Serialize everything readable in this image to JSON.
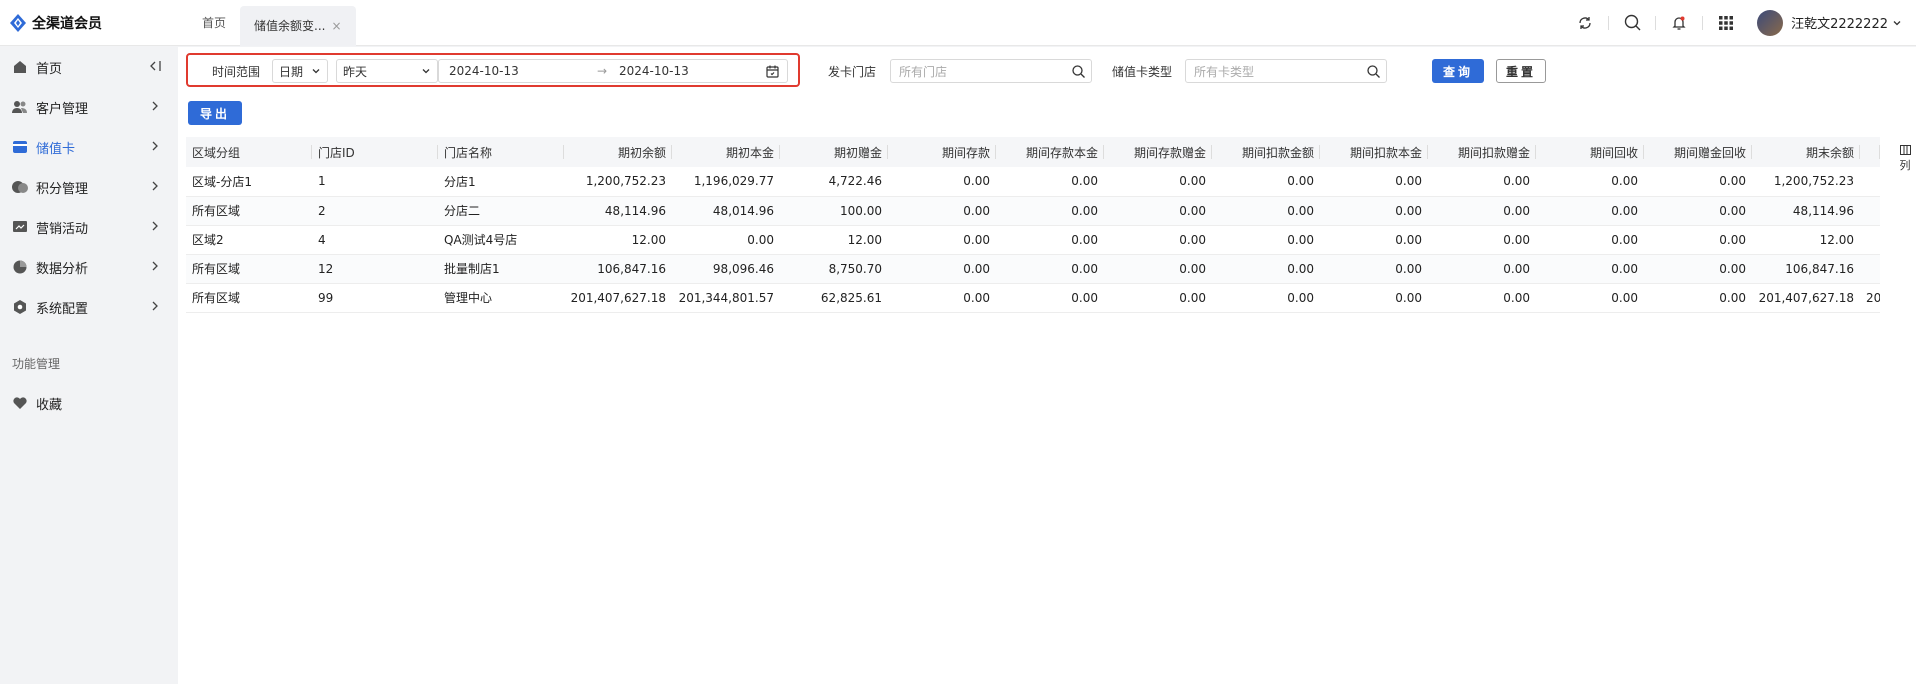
{
  "app": {
    "title": "全渠道会员"
  },
  "tabs": [
    {
      "label": "首页"
    },
    {
      "label": "储值余额变..."
    }
  ],
  "header": {
    "username": "汪乾文2222222"
  },
  "sidebar": {
    "items": [
      {
        "label": "首页"
      },
      {
        "label": "客户管理"
      },
      {
        "label": "储值卡"
      },
      {
        "label": "积分管理"
      },
      {
        "label": "营销活动"
      },
      {
        "label": "数据分析"
      },
      {
        "label": "系统配置"
      }
    ],
    "section_label": "功能管理",
    "favorites": {
      "label": "收藏"
    }
  },
  "filters": {
    "time_range_label": "时间范围",
    "time_unit": "日期",
    "period": "昨天",
    "start_date": "2024-10-13",
    "end_date": "2024-10-13",
    "range_sep": "→",
    "store_label": "发卡门店",
    "store_placeholder": "所有门店",
    "card_type_label": "储值卡类型",
    "card_type_placeholder": "所有卡类型",
    "query_label": "查询",
    "reset_label": "重置",
    "export_label": "导出"
  },
  "table": {
    "columns": [
      "区域分组",
      "门店ID",
      "门店名称",
      "期初余额",
      "期初本金",
      "期初赠金",
      "期间存款",
      "期间存款本金",
      "期间存款赠金",
      "期间扣款金额",
      "期间扣款本金",
      "期间扣款赠金",
      "期间回收",
      "期间赠金回收",
      "期末余额"
    ],
    "rows": [
      [
        "区域-分店1",
        "1",
        "分店1",
        "1,200,752.23",
        "1,196,029.77",
        "4,722.46",
        "0.00",
        "0.00",
        "0.00",
        "0.00",
        "0.00",
        "0.00",
        "0.00",
        "0.00",
        "1,200,752.23"
      ],
      [
        "所有区域",
        "2",
        "分店二",
        "48,114.96",
        "48,014.96",
        "100.00",
        "0.00",
        "0.00",
        "0.00",
        "0.00",
        "0.00",
        "0.00",
        "0.00",
        "0.00",
        "48,114.96"
      ],
      [
        "区域2",
        "4",
        "QA测试4号店",
        "12.00",
        "0.00",
        "12.00",
        "0.00",
        "0.00",
        "0.00",
        "0.00",
        "0.00",
        "0.00",
        "0.00",
        "0.00",
        "12.00"
      ],
      [
        "所有区域",
        "12",
        "批量制店1",
        "106,847.16",
        "98,096.46",
        "8,750.70",
        "0.00",
        "0.00",
        "0.00",
        "0.00",
        "0.00",
        "0.00",
        "0.00",
        "0.00",
        "106,847.16"
      ],
      [
        "所有区域",
        "99",
        "管理中心",
        "201,407,627.18",
        "201,344,801.57",
        "62,825.61",
        "0.00",
        "0.00",
        "0.00",
        "0.00",
        "0.00",
        "0.00",
        "0.00",
        "0.00",
        "201,407,627.18"
      ]
    ],
    "overflow_cell": "20",
    "column_toggle_label": "列"
  },
  "colors": {
    "primary": "#2f6bd7",
    "highlight": "#e03a2f",
    "header_bg": "#f5f6f8"
  }
}
